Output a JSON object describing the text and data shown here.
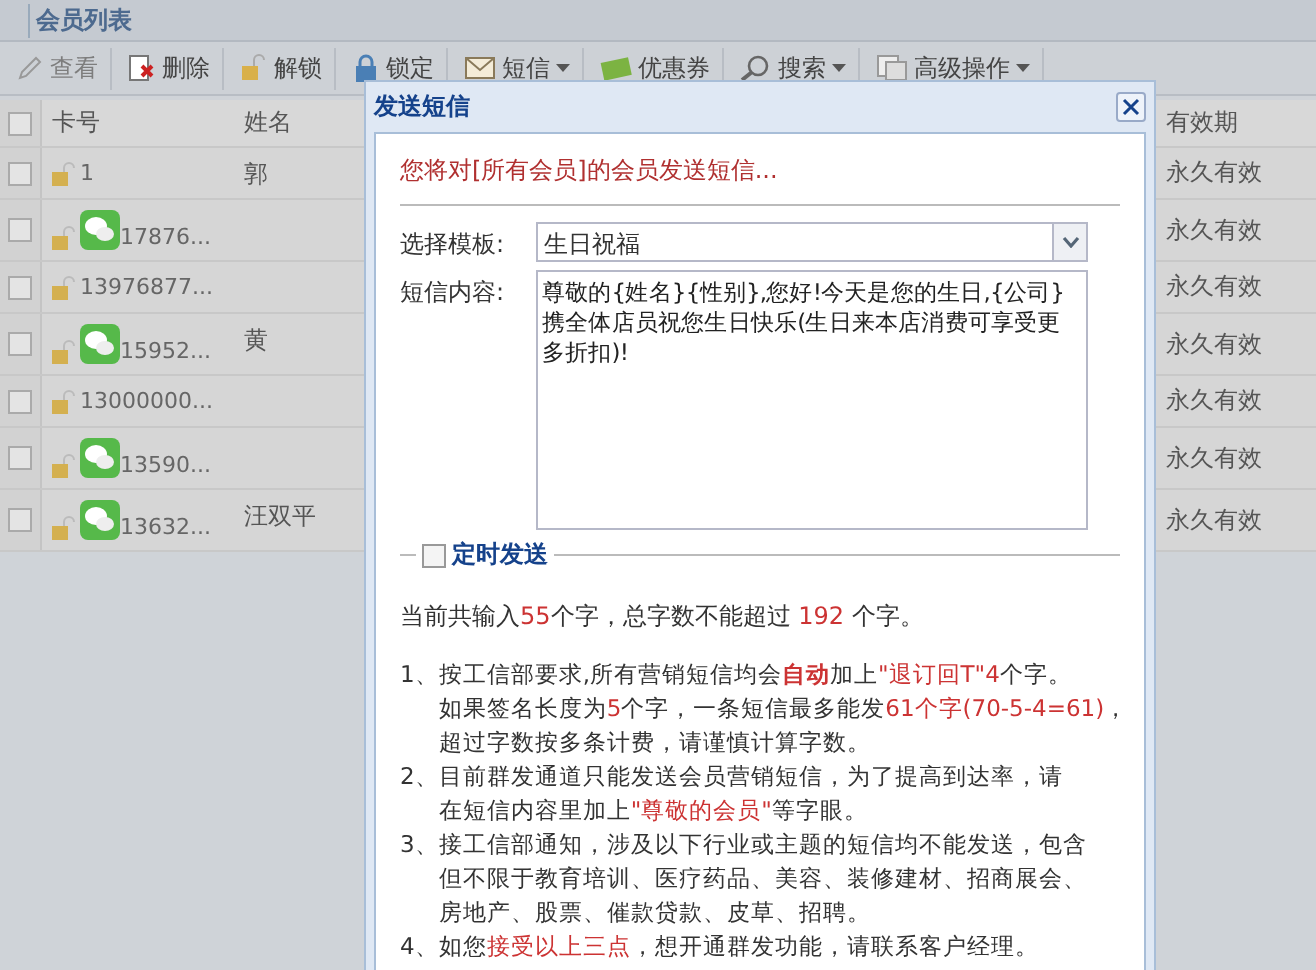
{
  "page_title": "会员列表",
  "toolbar": [
    {
      "label": "查看",
      "disabled": true,
      "dropdown": false
    },
    {
      "label": "删除",
      "disabled": false,
      "dropdown": false
    },
    {
      "label": "解锁",
      "disabled": false,
      "dropdown": false
    },
    {
      "label": "锁定",
      "disabled": false,
      "dropdown": false
    },
    {
      "label": "短信",
      "disabled": false,
      "dropdown": true
    },
    {
      "label": "优惠券",
      "disabled": false,
      "dropdown": false
    },
    {
      "label": "搜索",
      "disabled": false,
      "dropdown": true
    },
    {
      "label": "高级操作",
      "disabled": false,
      "dropdown": true
    }
  ],
  "grid": {
    "all_checked": false,
    "columns": [
      "卡号",
      "姓名",
      "有效期"
    ],
    "rows": [
      {
        "checked": false,
        "wechat": false,
        "card": "1",
        "name": "郭",
        "validity": "永久有效"
      },
      {
        "checked": false,
        "wechat": true,
        "card": "17876...",
        "validity": "永久有效"
      },
      {
        "checked": false,
        "wechat": false,
        "card": "13976877...",
        "validity": "永久有效"
      },
      {
        "checked": false,
        "wechat": true,
        "card": "15952...",
        "name": "黄",
        "validity": "永久有效"
      },
      {
        "checked": false,
        "wechat": false,
        "card": "13000000...",
        "validity": "永久有效"
      },
      {
        "checked": false,
        "wechat": true,
        "card": "13590...",
        "validity": "永久有效"
      },
      {
        "checked": false,
        "wechat": true,
        "card": "13632...",
        "name": "汪双平",
        "validity": "永久有效"
      }
    ]
  },
  "dialog": {
    "title": "发送短信",
    "notice": "您将对[所有会员]的会员发送短信...",
    "template_label": "选择模板:",
    "template_value": "生日祝福",
    "content_label": "短信内容:",
    "content_value": "尊敬的{姓名}{性别},您好!今天是您的生日,{公司}携全体店员祝您生日快乐(生日来本店消费可享受更多折扣)!",
    "schedule": {
      "label": "定时发送",
      "checked": false
    },
    "counter": [
      {
        "kind": "plain",
        "text": "当前共输入"
      },
      {
        "kind": "red",
        "text": "55"
      },
      {
        "kind": "plain",
        "text": "个字，总字数不能超过 "
      },
      {
        "kind": "red",
        "text": "192"
      },
      {
        "kind": "plain",
        "text": " 个字。"
      }
    ],
    "notes": [
      {
        "number": "1、",
        "segments": [
          {
            "kind": "plain",
            "text": "按工信部要求,所有营销短信均会"
          },
          {
            "kind": "bold",
            "text": "自动"
          },
          {
            "kind": "plain",
            "text": "加上"
          },
          {
            "kind": "red",
            "text": "\"退订回T\"4"
          },
          {
            "kind": "plain",
            "text": "个字。"
          },
          {
            "kind": "break"
          },
          {
            "kind": "plain",
            "text": "如果签名长度为"
          },
          {
            "kind": "red",
            "text": "5"
          },
          {
            "kind": "plain",
            "text": "个字，一条短信最多能发"
          },
          {
            "kind": "red",
            "text": "61个字(70-5-4=61)"
          },
          {
            "kind": "plain",
            "text": "，"
          },
          {
            "kind": "break"
          },
          {
            "kind": "plain",
            "text": "超过字数按多条计费，请谨慎计算字数。"
          }
        ]
      },
      {
        "number": "2、",
        "segments": [
          {
            "kind": "plain",
            "text": "目前群发通道只能发送会员营销短信，为了提高到达率，请"
          },
          {
            "kind": "break"
          },
          {
            "kind": "plain",
            "text": "在短信内容里加上"
          },
          {
            "kind": "red",
            "text": "\"尊敬的会员\""
          },
          {
            "kind": "plain",
            "text": "等字眼。"
          }
        ]
      },
      {
        "number": "3、",
        "segments": [
          {
            "kind": "plain",
            "text": "接工信部通知，涉及以下行业或主题的短信均不能发送，包含"
          },
          {
            "kind": "break"
          },
          {
            "kind": "plain",
            "text": "但不限于教育培训、医疗药品、美容、装修建材、招商展会、"
          },
          {
            "kind": "break"
          },
          {
            "kind": "plain",
            "text": "房地产、股票、催款贷款、皮草、招聘。"
          }
        ]
      },
      {
        "number": "4、",
        "segments": [
          {
            "kind": "plain",
            "text": "如您"
          },
          {
            "kind": "red",
            "text": "接受以上三点"
          },
          {
            "kind": "plain",
            "text": "，想开通群发功能，请联系客户经理。"
          }
        ]
      }
    ]
  }
}
